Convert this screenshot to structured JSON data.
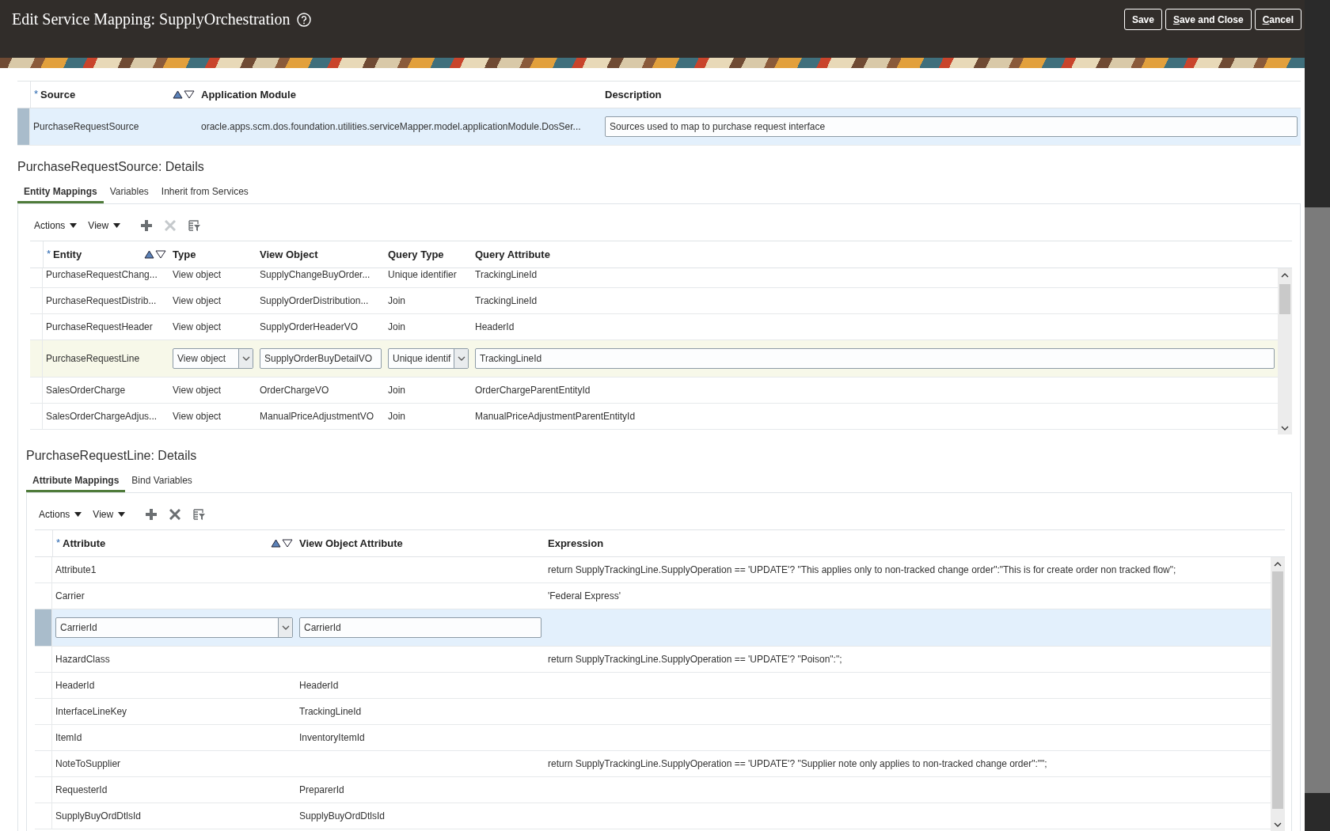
{
  "window": {
    "title": "Edit Service Mapping: SupplyOrchestration"
  },
  "header_buttons": [
    {
      "label": "Save",
      "first_letter_underlined": false
    },
    {
      "label": "Save and Close",
      "first_letter_underlined": true
    },
    {
      "label": "Cancel",
      "first_letter_underlined": true
    }
  ],
  "sources": {
    "focused": true,
    "columns": [
      {
        "label": "Source",
        "required_mark": "*",
        "sortable": true,
        "kind": "text"
      },
      {
        "label": "Application Module",
        "kind": "text"
      },
      {
        "label": "Description",
        "kind": "input"
      }
    ],
    "rows": [
      {
        "selected": true,
        "cells": [
          "PurchaseRequestSource",
          "oracle.apps.scm.dos.foundation.utilities.serviceMapper.model.applicationModule.DosSer...",
          "Sources used to map to purchase request interface"
        ]
      }
    ]
  },
  "source_details": {
    "title": "PurchaseRequestSource: Details",
    "tabs": [
      {
        "label": "Entity Mappings",
        "selected": true
      },
      {
        "label": "Variables",
        "selected": false
      },
      {
        "label": "Inherit from Services",
        "selected": false
      }
    ],
    "toolbar": {
      "menus": [
        "Actions",
        "View"
      ],
      "tools": [
        {
          "kind": "add",
          "disabled": false
        },
        {
          "kind": "delete",
          "disabled": true
        },
        {
          "kind": "filter",
          "disabled": false
        }
      ]
    },
    "table": {
      "focused": false,
      "columns": [
        {
          "label": "Entity",
          "required_mark": "*",
          "sortable": true,
          "kind": "text"
        },
        {
          "label": "Type",
          "kind": "select"
        },
        {
          "label": "View Object",
          "kind": "input"
        },
        {
          "label": "Query Type",
          "kind": "select"
        },
        {
          "label": "Query Attribute",
          "kind": "input"
        }
      ],
      "rows": [
        {
          "selected": false,
          "cells": [
            "PurchaseRequestChang...",
            "View object",
            "SupplyChangeBuyOrder...",
            "Unique identifier",
            "TrackingLineId"
          ]
        },
        {
          "selected": false,
          "cells": [
            "PurchaseRequestDistrib...",
            "View object",
            "SupplyOrderDistribution...",
            "Join",
            "TrackingLineId"
          ]
        },
        {
          "selected": false,
          "cells": [
            "PurchaseRequestHeader",
            "View object",
            "SupplyOrderHeaderVO",
            "Join",
            "HeaderId"
          ]
        },
        {
          "selected": true,
          "cells": [
            "PurchaseRequestLine",
            "View object",
            "SupplyOrderBuyDetailVO",
            "Unique identif",
            "TrackingLineId"
          ]
        },
        {
          "selected": false,
          "cells": [
            "SalesOrderCharge",
            "View object",
            "OrderChargeVO",
            "Join",
            "OrderChargeParentEntityId"
          ]
        },
        {
          "selected": false,
          "cells": [
            "SalesOrderChargeAdjus...",
            "View object",
            "ManualPriceAdjustmentVO",
            "Join",
            "ManualPriceAdjustmentParentEntityId"
          ]
        }
      ]
    }
  },
  "line_details": {
    "title": "PurchaseRequestLine: Details",
    "tabs": [
      {
        "label": "Attribute Mappings",
        "selected": true
      },
      {
        "label": "Bind Variables",
        "selected": false
      }
    ],
    "toolbar": {
      "menus": [
        "Actions",
        "View"
      ],
      "tools": [
        {
          "kind": "add",
          "disabled": false
        },
        {
          "kind": "delete",
          "disabled": false
        },
        {
          "kind": "filter",
          "disabled": false
        }
      ]
    },
    "table": {
      "focused": true,
      "columns": [
        {
          "label": "Attribute",
          "required_mark": "*",
          "sortable": true,
          "kind": "select"
        },
        {
          "label": "View Object Attribute",
          "kind": "input"
        },
        {
          "label": "Expression",
          "kind": "text"
        }
      ],
      "rows": [
        {
          "selected": false,
          "cells": [
            "Attribute1",
            null,
            "return SupplyTrackingLine.SupplyOperation == 'UPDATE'? \"This applies only to non-tracked change order\":\"This is for create order non tracked flow\";"
          ]
        },
        {
          "selected": false,
          "cells": [
            "Carrier",
            null,
            "'Federal Express'"
          ]
        },
        {
          "selected": true,
          "cells": [
            "CarrierId",
            "CarrierId",
            null
          ]
        },
        {
          "selected": false,
          "cells": [
            "HazardClass",
            null,
            "return SupplyTrackingLine.SupplyOperation == 'UPDATE'? \"Poison\":\";"
          ]
        },
        {
          "selected": false,
          "cells": [
            "HeaderId",
            "HeaderId",
            null
          ]
        },
        {
          "selected": false,
          "cells": [
            "InterfaceLineKey",
            "TrackingLineId",
            null
          ]
        },
        {
          "selected": false,
          "cells": [
            "ItemId",
            "InventoryItemId",
            null
          ]
        },
        {
          "selected": false,
          "cells": [
            "NoteToSupplier",
            null,
            "return SupplyTrackingLine.SupplyOperation == 'UPDATE'? \"Supplier note only applies to non-tracked change order\":\"\";"
          ]
        },
        {
          "selected": false,
          "cells": [
            "RequesterId",
            "PreparerId",
            null
          ]
        },
        {
          "selected": false,
          "cells": [
            "SupplyBuyOrdDtlsId",
            "SupplyBuyOrdDtlsId",
            null
          ]
        }
      ]
    }
  }
}
